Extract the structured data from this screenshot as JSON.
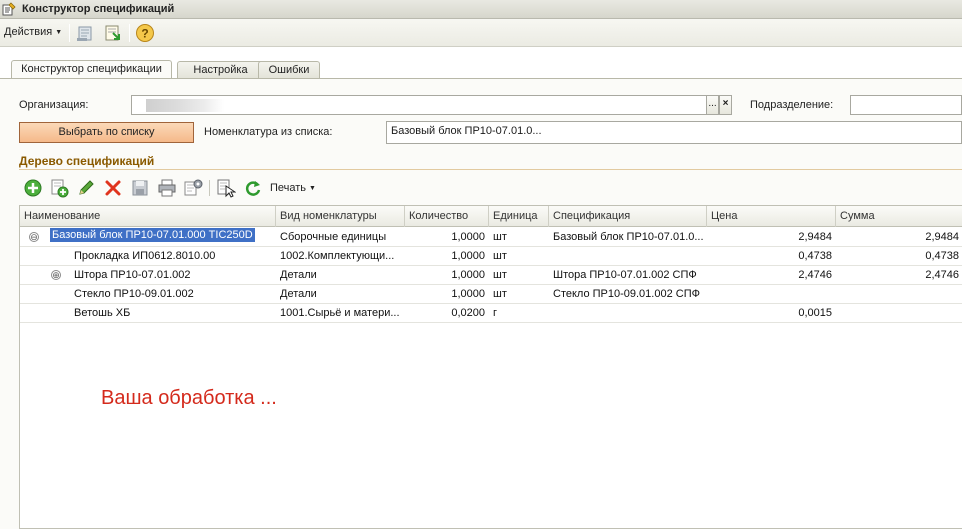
{
  "window": {
    "title": "Конструктор спецификаций"
  },
  "toolbar": {
    "actions_label": "Действия",
    "icons": [
      "export-document-icon",
      "import-document-icon",
      "help-icon"
    ]
  },
  "tabs": [
    {
      "label": "Конструктор спецификации",
      "active": true
    },
    {
      "label": "Настройка",
      "active": false
    },
    {
      "label": "Ошибки",
      "active": false
    }
  ],
  "form": {
    "organization_label": "Организация:",
    "organization_value": "",
    "ellipsis_symbol": "...",
    "clear_symbol": "×",
    "subdivision_label": "Подразделение:",
    "subdivision_value": "",
    "select_button_label": "Выбрать по списку",
    "nomenclature_label": "Номенклатура из списка:",
    "nomenclature_value": "Базовый блок ПР10-07.01.0..."
  },
  "tree": {
    "section_title": "Дерево спецификаций",
    "print_label": "Печать",
    "columns": [
      "Наименование",
      "Вид номенклатуры",
      "Количество",
      "Единица",
      "Спецификация",
      "Цена",
      "Сумма"
    ],
    "rows": [
      {
        "expander": "⊖",
        "name": "Базовый блок ПР10-07.01.000 TIC250D",
        "kind": "Сборочные единицы",
        "qty": "1,0000",
        "unit": "шт",
        "spec": "Базовый блок ПР10-07.01.0...",
        "price": "2,9484",
        "sum": "2,9484",
        "selected": true
      },
      {
        "expander": "",
        "name": "Прокладка ИП0612.8010.00",
        "kind": "1002.Комплектующи...",
        "qty": "1,0000",
        "unit": "шт",
        "spec": "",
        "price": "0,4738",
        "sum": "0,4738",
        "selected": false
      },
      {
        "expander": "⊕",
        "name": "Штора ПР10-07.01.002",
        "kind": "Детали",
        "qty": "1,0000",
        "unit": "шт",
        "spec": "Штора ПР10-07.01.002 СПФ",
        "price": "2,4746",
        "sum": "2,4746",
        "selected": false
      },
      {
        "expander": "",
        "name": "Стекло ПР10-09.01.002",
        "kind": "Детали",
        "qty": "1,0000",
        "unit": "шт",
        "spec": "Стекло ПР10-09.01.002 СПФ",
        "price": "",
        "sum": "",
        "selected": false
      },
      {
        "expander": "",
        "name": "Ветошь ХБ",
        "kind": "1001.Сырьё и матери...",
        "qty": "0,0200",
        "unit": "г",
        "spec": "",
        "price": "0,0015",
        "sum": "",
        "selected": false
      }
    ]
  },
  "annotation": "Ваша обработка ...",
  "colors": {
    "accent_orange": "#f5b98a",
    "selection_blue": "#3f70c6",
    "annotation_red": "#d42a1c",
    "section_title": "#8a5a00"
  }
}
